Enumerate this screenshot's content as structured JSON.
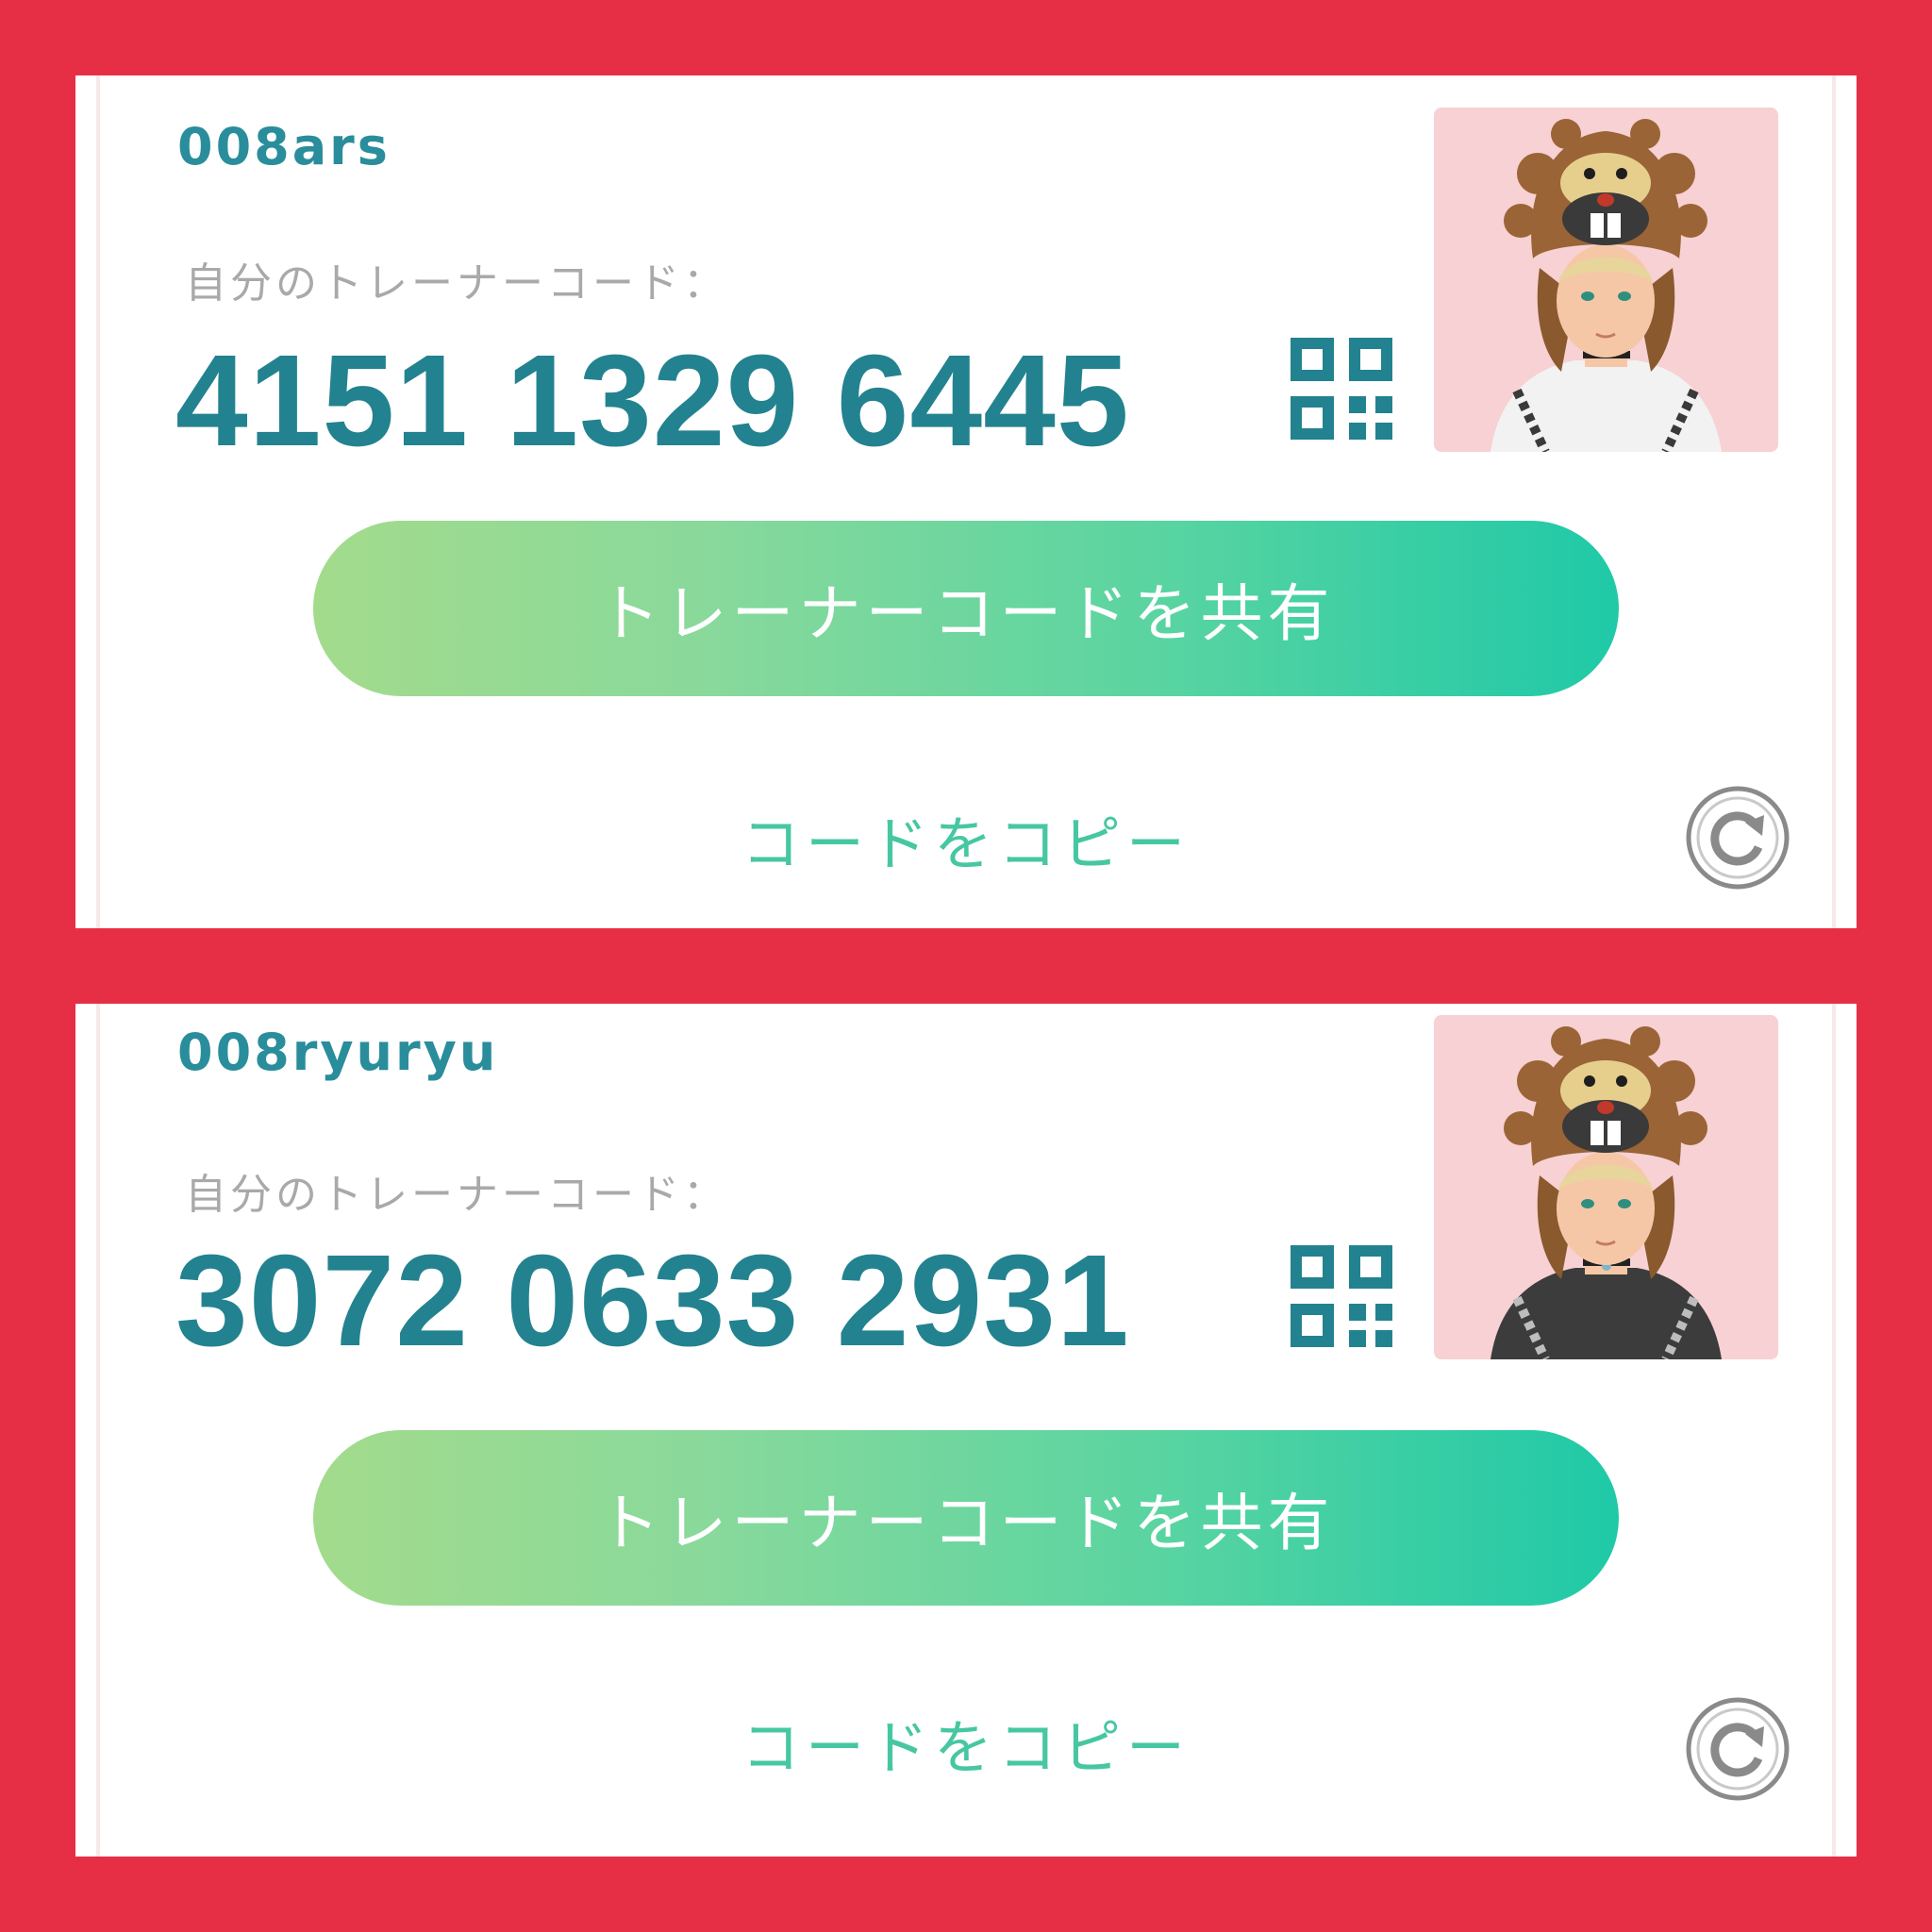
{
  "colors": {
    "frame_background": "#e62e45",
    "card_background": "#ffffff",
    "username_text": "#2a8d9b",
    "code_text": "#23828f",
    "label_text": "#a9a9a9",
    "share_gradient_start": "#a3db8c",
    "share_gradient_end": "#1fc9a7",
    "copy_link_text": "#46c7a2",
    "avatar_background": "#f7d1d3",
    "refresh_icon": "#8a8a8a"
  },
  "cards": [
    {
      "username": "008ars",
      "code_label": "自分のトレーナーコード：",
      "trainer_code": "4151 1329 6445",
      "qr_icon": "qr-code-icon",
      "avatar_icon": "trainer-avatar",
      "avatar_shirt": "light",
      "share_label": "トレーナーコードを共有",
      "copy_label": "コードをコピー",
      "refresh_icon": "refresh-icon"
    },
    {
      "username": "008ryuryu",
      "code_label": "自分のトレーナーコード：",
      "trainer_code": "3072 0633 2931",
      "qr_icon": "qr-code-icon",
      "avatar_icon": "trainer-avatar",
      "avatar_shirt": "dark",
      "share_label": "トレーナーコードを共有",
      "copy_label": "コードをコピー",
      "refresh_icon": "refresh-icon"
    }
  ]
}
